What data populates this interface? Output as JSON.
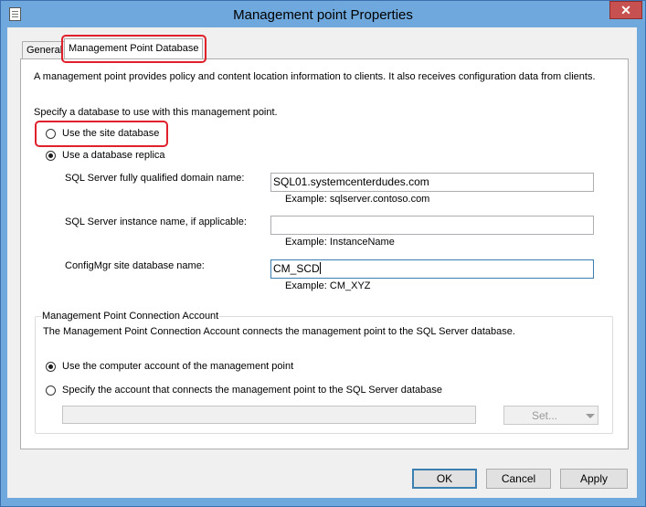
{
  "window": {
    "title": "Management point Properties",
    "close_glyph": "✕"
  },
  "tabs": [
    {
      "label": "General",
      "active": false
    },
    {
      "label": "Management Point Database",
      "active": true
    }
  ],
  "intro_text": "A management point provides policy and content location information to clients.  It also receives configuration data from clients.",
  "database_section": {
    "prompt": "Specify a database to use with this management point.",
    "options": [
      {
        "label": "Use the site database",
        "selected": false
      },
      {
        "label": "Use a database replica",
        "selected": true
      }
    ],
    "fields": [
      {
        "label": "SQL Server fully qualified domain name:",
        "value": "SQL01.systemcenterdudes.com",
        "example": "Example: sqlserver.contoso.com"
      },
      {
        "label": "SQL Server instance name, if applicable:",
        "value": "",
        "example": "Example: InstanceName"
      },
      {
        "label": "ConfigMgr site database name:",
        "value": "CM_SCD",
        "example": "Example: CM_XYZ"
      }
    ]
  },
  "connection_account": {
    "group_title": "Management Point Connection Account",
    "description": "The Management Point Connection Account connects the management point to the SQL Server database.",
    "options": [
      {
        "label": "Use the computer account of the management point",
        "selected": true
      },
      {
        "label": "Specify the account that connects the management point to the SQL Server database",
        "selected": false
      }
    ],
    "account_value": "",
    "set_button": "Set..."
  },
  "footer_buttons": {
    "ok": "OK",
    "cancel": "Cancel",
    "apply": "Apply"
  },
  "colors": {
    "highlight": "#e0202a",
    "title_bar": "#6fa8dc",
    "close_button": "#c75050"
  }
}
